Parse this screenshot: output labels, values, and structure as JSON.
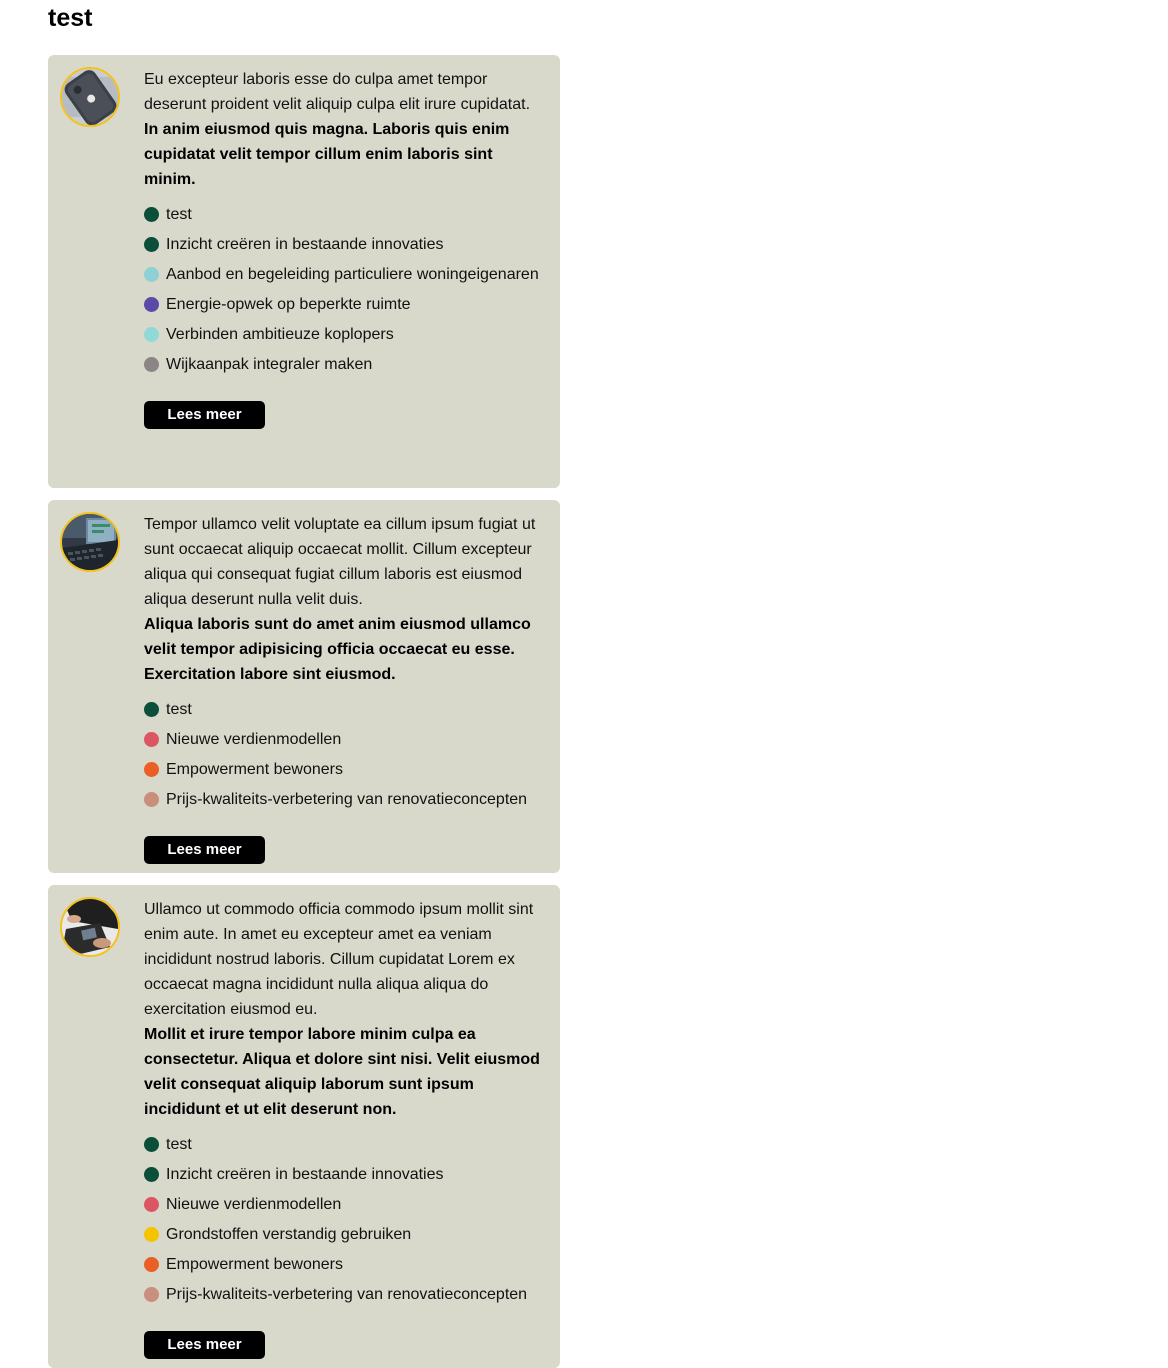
{
  "page": {
    "title": "test"
  },
  "colors": {
    "card_bg": "#d9d9cb",
    "avatar_ring": "#f3c21b",
    "button_bg": "#000000",
    "button_text": "#ffffff"
  },
  "cards": [
    {
      "avatar_icon": "phone-photo",
      "description": "Eu excepteur laboris esse do culpa amet tempor deserunt proident velit aliquip culpa elit irure cupidatat.",
      "highlight": "In anim eiusmod quis magna. Laboris quis enim cupidatat velit tempor cillum enim laboris sint minim.",
      "tags": [
        {
          "label": "test",
          "color": "#0b4f3a"
        },
        {
          "label": "Inzicht creëren in bestaande innovaties",
          "color": "#0b4f3a"
        },
        {
          "label": "Aanbod en begeleiding particuliere woningeigenaren",
          "color": "#8fd0d4"
        },
        {
          "label": "Energie-opwek op beperkte ruimte",
          "color": "#5b4aa6"
        },
        {
          "label": "Verbinden ambitieuze koplopers",
          "color": "#8fdad6"
        },
        {
          "label": "Wijkaanpak integraler maken",
          "color": "#8c8585"
        }
      ],
      "button_label": "Lees meer"
    },
    {
      "avatar_icon": "laptop-photo",
      "description": "Tempor ullamco velit voluptate ea cillum ipsum fugiat ut sunt occaecat aliquip occaecat mollit. Cillum excepteur aliqua qui consequat fugiat cillum laboris est eiusmod aliqua deserunt nulla velit duis.",
      "highlight": "Aliqua laboris sunt do amet anim eiusmod ullamco velit tempor adipisicing officia occaecat eu esse. Exercitation labore sint eiusmod.",
      "tags": [
        {
          "label": "test",
          "color": "#0b4f3a"
        },
        {
          "label": "Nieuwe verdienmodellen",
          "color": "#dc5563"
        },
        {
          "label": "Empowerment bewoners",
          "color": "#ea5f25"
        },
        {
          "label": "Prijs-kwaliteits-verbetering van renovatieconcepten",
          "color": "#c98e7c"
        }
      ],
      "button_label": "Lees meer"
    },
    {
      "avatar_icon": "desk-photo",
      "description": "Ullamco ut commodo officia commodo ipsum mollit sint enim aute. In amet eu excepteur amet ea veniam incididunt nostrud laboris. Cillum cupidatat Lorem ex occaecat magna incididunt nulla aliqua aliqua do exercitation eiusmod eu.",
      "highlight": "Mollit et irure tempor labore minim culpa ea consectetur. Aliqua et dolore sint nisi. Velit eiusmod velit consequat aliquip laborum sunt ipsum incididunt et ut elit deserunt non.",
      "tags": [
        {
          "label": "test",
          "color": "#0b4f3a"
        },
        {
          "label": "Inzicht creëren in bestaande innovaties",
          "color": "#0b4f3a"
        },
        {
          "label": "Nieuwe verdienmodellen",
          "color": "#dc5563"
        },
        {
          "label": "Grondstoffen verstandig gebruiken",
          "color": "#f6c300"
        },
        {
          "label": "Empowerment bewoners",
          "color": "#ea5f25"
        },
        {
          "label": "Prijs-kwaliteits-verbetering van renovatieconcepten",
          "color": "#c98e7c"
        }
      ],
      "button_label": "Lees meer"
    }
  ]
}
